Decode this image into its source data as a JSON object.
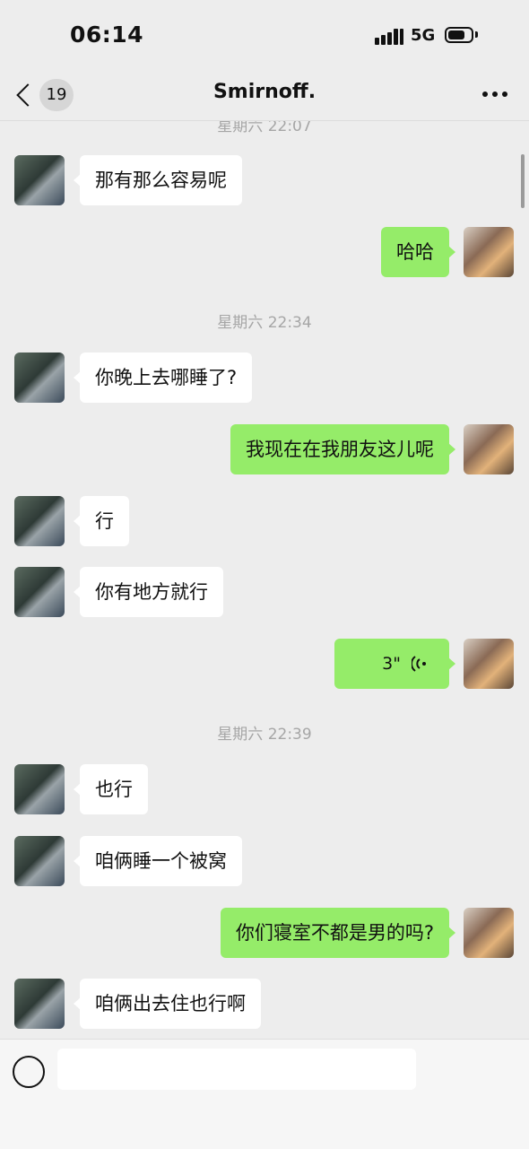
{
  "status_bar": {
    "time": "06:14",
    "network": "5G"
  },
  "nav": {
    "back_count": "19",
    "title": "Smirnoff."
  },
  "timestamps": {
    "t0": "星期六 22:07",
    "t1": "星期六 22:34",
    "t2": "星期六 22:39"
  },
  "messages": [
    {
      "side": "in",
      "text": "那有那么容易呢"
    },
    {
      "side": "out",
      "text": "哈哈"
    },
    {
      "side": "in",
      "text": "你晚上去哪睡了?"
    },
    {
      "side": "out",
      "text": "我现在在我朋友这儿呢"
    },
    {
      "side": "in",
      "text": "行"
    },
    {
      "side": "in",
      "text": "你有地方就行"
    },
    {
      "side": "out",
      "type": "voice",
      "duration": "3\""
    },
    {
      "side": "in",
      "text": "也行"
    },
    {
      "side": "in",
      "text": "咱俩睡一个被窝"
    },
    {
      "side": "out",
      "text": "你们寝室不都是男的吗?"
    },
    {
      "side": "in",
      "text": "咱俩出去住也行啊"
    }
  ],
  "colors": {
    "sent_bubble": "#95ec69",
    "received_bubble": "#ffffff",
    "background": "#ededed"
  }
}
